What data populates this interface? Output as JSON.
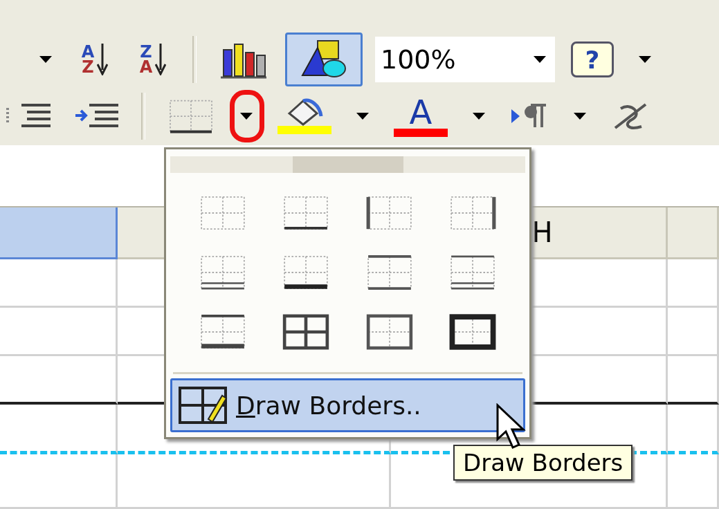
{
  "standard_toolbar": {
    "items": [
      {
        "kind": "caret",
        "annotated": false
      },
      {
        "kind": "sort",
        "letters": [
          "A",
          "Z"
        ]
      },
      {
        "kind": "sort",
        "letters": [
          "Z",
          "A"
        ]
      },
      {
        "kind": "separator"
      },
      {
        "kind": "chart"
      },
      {
        "kind": "drawing",
        "selected": true
      },
      {
        "kind": "zoom",
        "value": "100%"
      },
      {
        "kind": "help",
        "label": "?"
      },
      {
        "kind": "caret",
        "annotated": false
      }
    ]
  },
  "formatting_toolbar": {
    "items": [
      {
        "kind": "decrease-indent"
      },
      {
        "kind": "increase-indent"
      },
      {
        "kind": "separator"
      },
      {
        "kind": "borders"
      },
      {
        "kind": "caret",
        "annotated": true
      },
      {
        "kind": "fill-color",
        "color": "#ffff00"
      },
      {
        "kind": "caret",
        "annotated": false
      },
      {
        "kind": "font-color",
        "label": "A",
        "color": "#ff0000"
      },
      {
        "kind": "caret",
        "annotated": false
      },
      {
        "kind": "ltr"
      },
      {
        "kind": "caret",
        "annotated": false
      },
      {
        "kind": "phonetic"
      }
    ]
  },
  "sheet": {
    "column_headers": [
      {
        "selected": true
      },
      {
        "selected": false
      },
      {
        "label": "H",
        "selected": false
      },
      {
        "selected": false
      }
    ]
  },
  "borders_menu": {
    "options": [
      {
        "kind": "none"
      },
      {
        "kind": "bottom"
      },
      {
        "kind": "left"
      },
      {
        "kind": "right"
      },
      {
        "kind": "double-bottom"
      },
      {
        "kind": "thick-bottom"
      },
      {
        "kind": "top-bottom"
      },
      {
        "kind": "top-double-bottom"
      },
      {
        "kind": "top-thick-bottom"
      },
      {
        "kind": "all"
      },
      {
        "kind": "outside"
      },
      {
        "kind": "thick-box"
      }
    ],
    "draw_item": {
      "label": "Draw Borders..",
      "selected": true
    }
  },
  "tooltip": {
    "text": "Draw Borders"
  }
}
